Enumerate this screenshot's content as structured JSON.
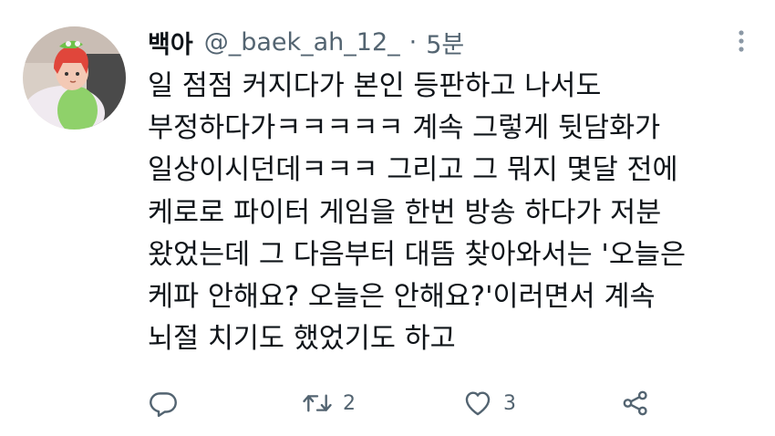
{
  "tweet": {
    "display_name": "백아",
    "handle": "@_baek_ah_12_",
    "separator": "·",
    "time": "5분",
    "text": "일 점점 커지다가 본인 등판하고 나서도\n부정하다가ㅋㅋㅋㅋㅋ 계속 그렇게 뒷담화가\n일상이시던데ㅋㅋㅋ 그리고 그 뭐지 몇달 전에\n케로로 파이터 게임을 한번 방송 하다가 저분\n왔었는데 그 다음부터 대뜸 찾아와서는 '오늘은\n케파 안해요? 오늘은 안해요?'이러면서 계속\n뇌절 치기도 했었기도 하고"
  },
  "actions": {
    "reply_icon": "reply-icon",
    "retweet_icon": "retweet-icon",
    "retweet_count": "2",
    "like_icon": "heart-icon",
    "like_count": "3",
    "share_icon": "share-icon"
  },
  "colors": {
    "text": "#0f1419",
    "secondary": "#536471",
    "background": "#ffffff"
  }
}
